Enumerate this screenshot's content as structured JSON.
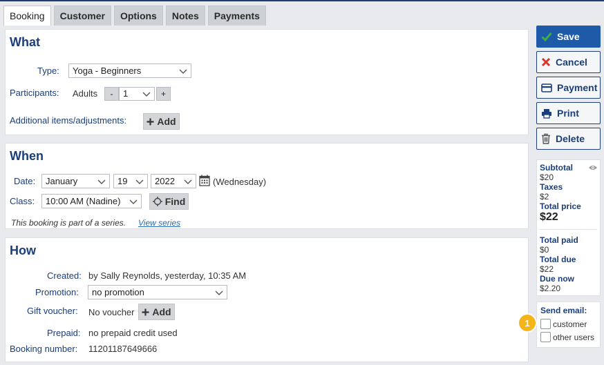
{
  "tabs": [
    {
      "label": "Booking"
    },
    {
      "label": "Customer"
    },
    {
      "label": "Options"
    },
    {
      "label": "Notes"
    },
    {
      "label": "Payments"
    }
  ],
  "what": {
    "title": "What",
    "type_label": "Type:",
    "type_value": "Yoga - Beginners",
    "participants_label": "Participants:",
    "adults_label": "Adults",
    "minus": "-",
    "adults_value": "1",
    "plus": "+",
    "additional_label": "Additional items/adjustments:",
    "add_label": "Add"
  },
  "when": {
    "title": "When",
    "date_label": "Date:",
    "month": "January",
    "day": "19",
    "year": "2022",
    "weekday": "(Wednesday)",
    "class_label": "Class:",
    "class_value": "10:00 AM (Nadine)",
    "find_label": "Find",
    "series_text": "This booking is part of a series.",
    "series_link": "View series"
  },
  "how": {
    "title": "How",
    "created_label": "Created:",
    "created_value": "by Sally Reynolds, yesterday, 10:35 AM",
    "promotion_label": "Promotion:",
    "promotion_value": "no promotion",
    "gift_label": "Gift voucher:",
    "gift_value": "No voucher",
    "gift_add": "Add",
    "prepaid_label": "Prepaid:",
    "prepaid_value": "no prepaid credit used",
    "booking_number_label": "Booking number:",
    "booking_number_value": "11201187649666"
  },
  "actions": {
    "save": "Save",
    "cancel": "Cancel",
    "payment": "Payment",
    "print": "Print",
    "delete": "Delete"
  },
  "summary": {
    "subtotal_label": "Subtotal",
    "subtotal": "$20",
    "taxes_label": "Taxes",
    "taxes": "$2",
    "total_price_label": "Total price",
    "total_price": "$22",
    "total_paid_label": "Total paid",
    "total_paid": "$0",
    "total_due_label": "Total due",
    "total_due": "$22",
    "due_now_label": "Due now",
    "due_now": "$2.20"
  },
  "email": {
    "label": "Send email:",
    "customer": "customer",
    "other_users": "other users"
  },
  "badge": "1",
  "colors": {
    "accent": "#1a3d7c",
    "primary_button": "#1f5aa8",
    "badge": "#f4b41a",
    "cancel_icon": "#d9352b",
    "save_icon": "#3cb043"
  }
}
